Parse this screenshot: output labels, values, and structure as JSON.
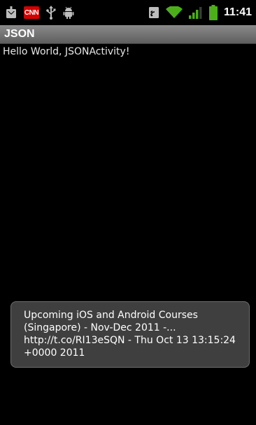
{
  "status_bar": {
    "notifications": [
      "download-icon",
      "cnn-icon",
      "usb-icon",
      "android-debug-icon"
    ],
    "cnn_label": "CNN",
    "system": [
      "data-sync-icon",
      "wifi-icon",
      "signal-icon",
      "battery-icon"
    ],
    "time": "11:41",
    "colors": {
      "battery": "#4caf1a",
      "wifi": "#4caf1a",
      "signal": "#4caf1a",
      "cnn": "#d40000"
    }
  },
  "app": {
    "title": "JSON",
    "message": "Hello World, JSONActivity!"
  },
  "toast": {
    "text": "Upcoming iOS and Android Courses (Singapore) - Nov-Dec 2011 -... http://t.co/RI13eSQN - Thu Oct 13 13:15:24 +0000 2011"
  }
}
